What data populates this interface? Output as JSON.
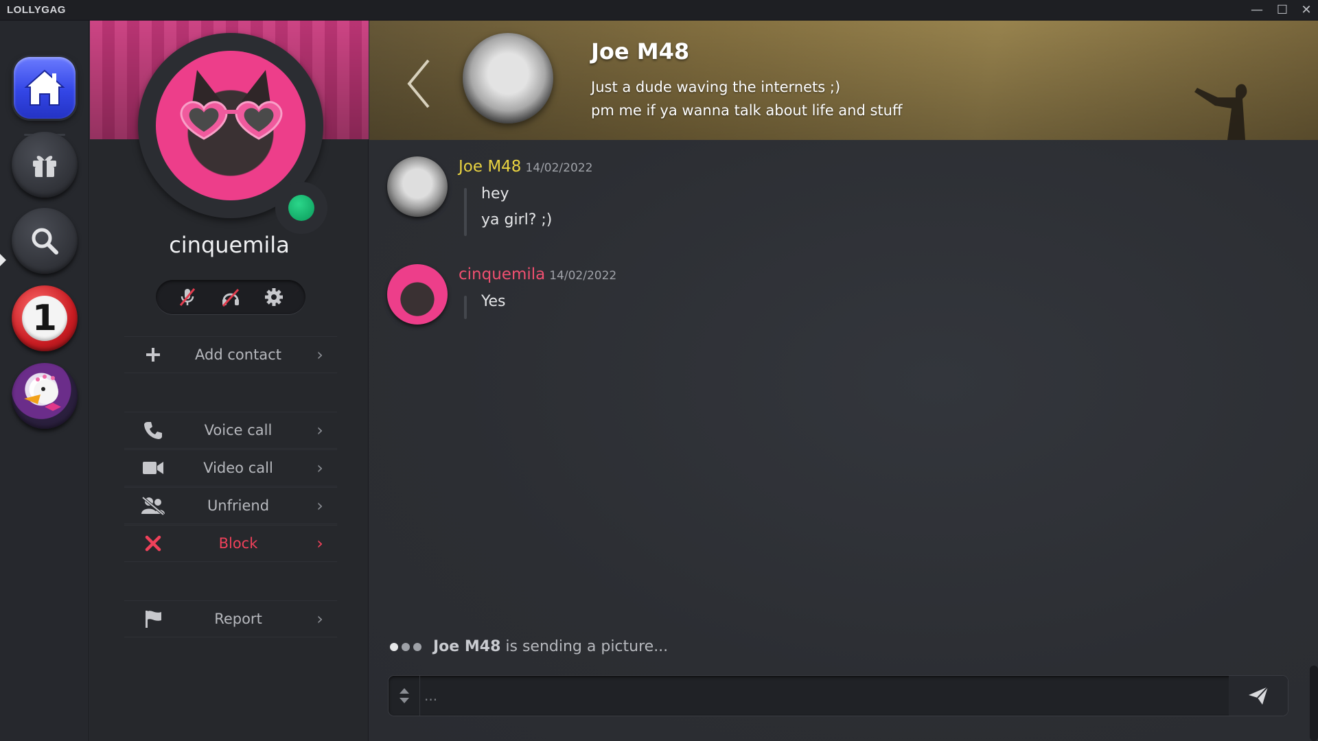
{
  "app": {
    "title": "LOLLYGAG"
  },
  "window_controls": {
    "minimize": "—",
    "maximize": "☐",
    "close": "✕"
  },
  "rail": {
    "notification_count": "1",
    "items": [
      "home-icon",
      "gift-icon",
      "search-icon",
      "notification-badge",
      "server-avatar"
    ]
  },
  "profile": {
    "username": "cinquemila",
    "status_color": "#1fbf74",
    "quick_actions": [
      "mute-mic-icon",
      "deafen-icon",
      "settings-gear-icon"
    ],
    "menu": [
      {
        "label": "Add contact",
        "icon": "plus-icon"
      },
      {
        "label": "Voice call",
        "icon": "phone-icon"
      },
      {
        "label": "Video call",
        "icon": "video-camera-icon"
      },
      {
        "label": "Unfriend",
        "icon": "unfriend-icon"
      },
      {
        "label": "Block",
        "icon": "close-x-icon"
      },
      {
        "label": "Report",
        "icon": "flag-icon"
      }
    ],
    "danger_color": "#f0415a"
  },
  "chat": {
    "header": {
      "name": "Joe M48",
      "bio_line1": "Just a dude waving the internets ;)",
      "bio_line2": "pm me if ya wanna talk about life and stuff"
    },
    "messages": [
      {
        "author": "Joe M48",
        "author_color": "#e9d341",
        "date": "14/02/2022",
        "lines": [
          "hey",
          "ya girl? ;)"
        ]
      },
      {
        "author": "cinquemila",
        "author_color": "#f05070",
        "date": "14/02/2022",
        "lines": [
          "Yes"
        ]
      }
    ],
    "typing": {
      "user": "Joe M48",
      "text": "is sending a picture..."
    },
    "composer": {
      "placeholder": "...",
      "value": ""
    }
  }
}
